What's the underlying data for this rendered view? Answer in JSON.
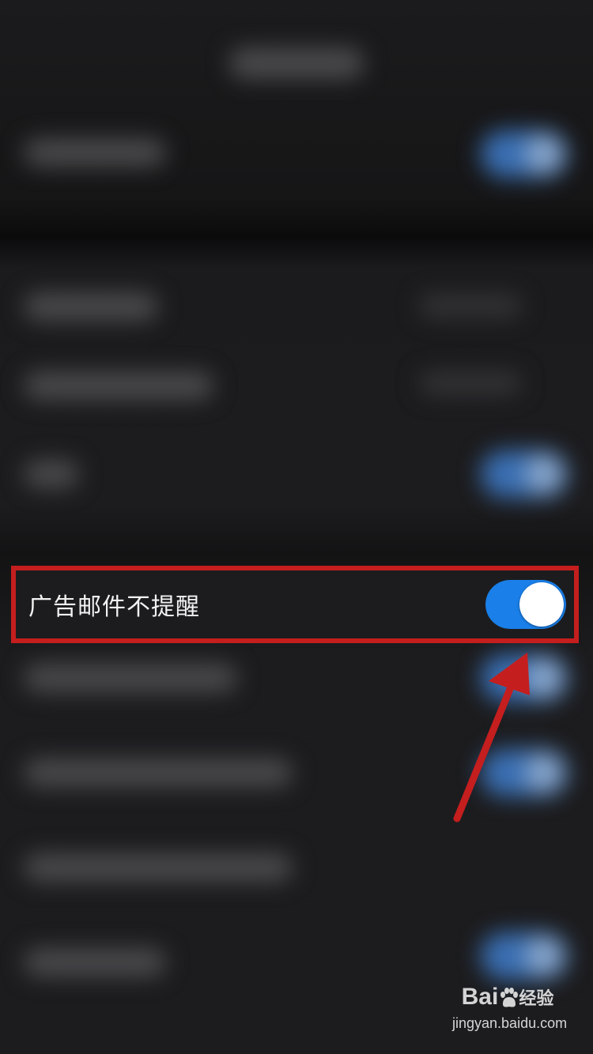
{
  "setting": {
    "label": "广告邮件不提醒",
    "toggle_state": "on"
  },
  "watermark": {
    "brand_left": "Bai",
    "brand_right": "经验",
    "url": "jingyan.baidu.com"
  },
  "colors": {
    "toggle_on": "#1a7fe8",
    "highlight_box": "#c41e1e",
    "arrow": "#c41e1e",
    "background": "#1c1c1e"
  }
}
